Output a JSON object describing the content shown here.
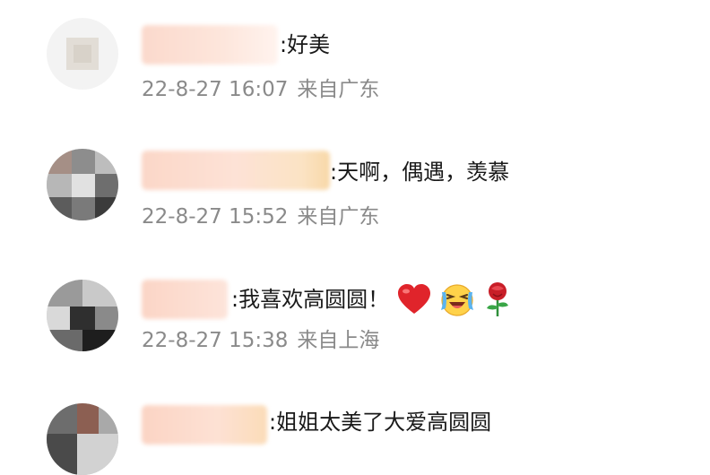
{
  "comments": [
    {
      "text": ":好美",
      "timestamp": "22-8-27 16:07",
      "location": "来自广东"
    },
    {
      "text": ":天啊，偶遇，羡慕",
      "timestamp": "22-8-27 15:52",
      "location": "来自广东"
    },
    {
      "text": ":我喜欢高圆圆！",
      "timestamp": "22-8-27 15:38",
      "location": "来自上海",
      "emojis": [
        "heart-emoji",
        "laughing-crying-emoji",
        "rose-emoji"
      ]
    },
    {
      "text": ":姐姐太美了大爱高圆圆"
    }
  ],
  "colors": {
    "username_blur": "#f6c9b8",
    "text": "#1a1a1a",
    "meta": "#8a8a8a",
    "heart": "#e0242b",
    "rose": "#c81e28"
  }
}
